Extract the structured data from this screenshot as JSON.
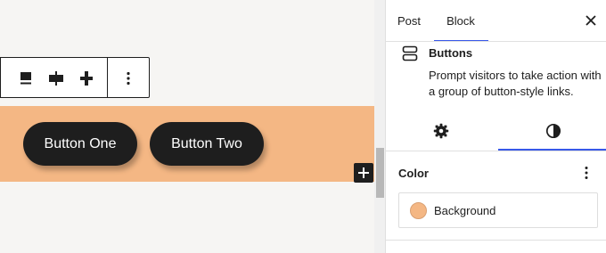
{
  "canvas": {
    "toolbar": {
      "justify_left_icon": "justify-left-icon",
      "justify_center_icon": "justify-center-icon",
      "justify_space_between_icon": "justify-space-between-icon",
      "more_icon": "more-vertical-icon"
    },
    "buttons_block": {
      "background_color": "#f4b784",
      "button_color": "#1e1e1e",
      "items": [
        {
          "label": "Button One"
        },
        {
          "label": "Button Two"
        }
      ]
    },
    "add_block_icon": "plus-icon"
  },
  "sidebar": {
    "tabs": [
      {
        "label": "Post",
        "active": false
      },
      {
        "label": "Block",
        "active": true
      }
    ],
    "close_icon": "close-icon",
    "accent_color": "#3858e9",
    "block_card": {
      "icon": "buttons-icon",
      "title": "Buttons",
      "description": "Prompt visitors to take action with a group of button-style links."
    },
    "sub_tabs": [
      {
        "icon": "gear-icon",
        "active": false
      },
      {
        "icon": "styles-icon",
        "active": true
      }
    ],
    "color_panel": {
      "title": "Color",
      "options_icon": "more-vertical-icon",
      "items": [
        {
          "label": "Background",
          "swatch_color": "#f4b784"
        }
      ]
    }
  }
}
